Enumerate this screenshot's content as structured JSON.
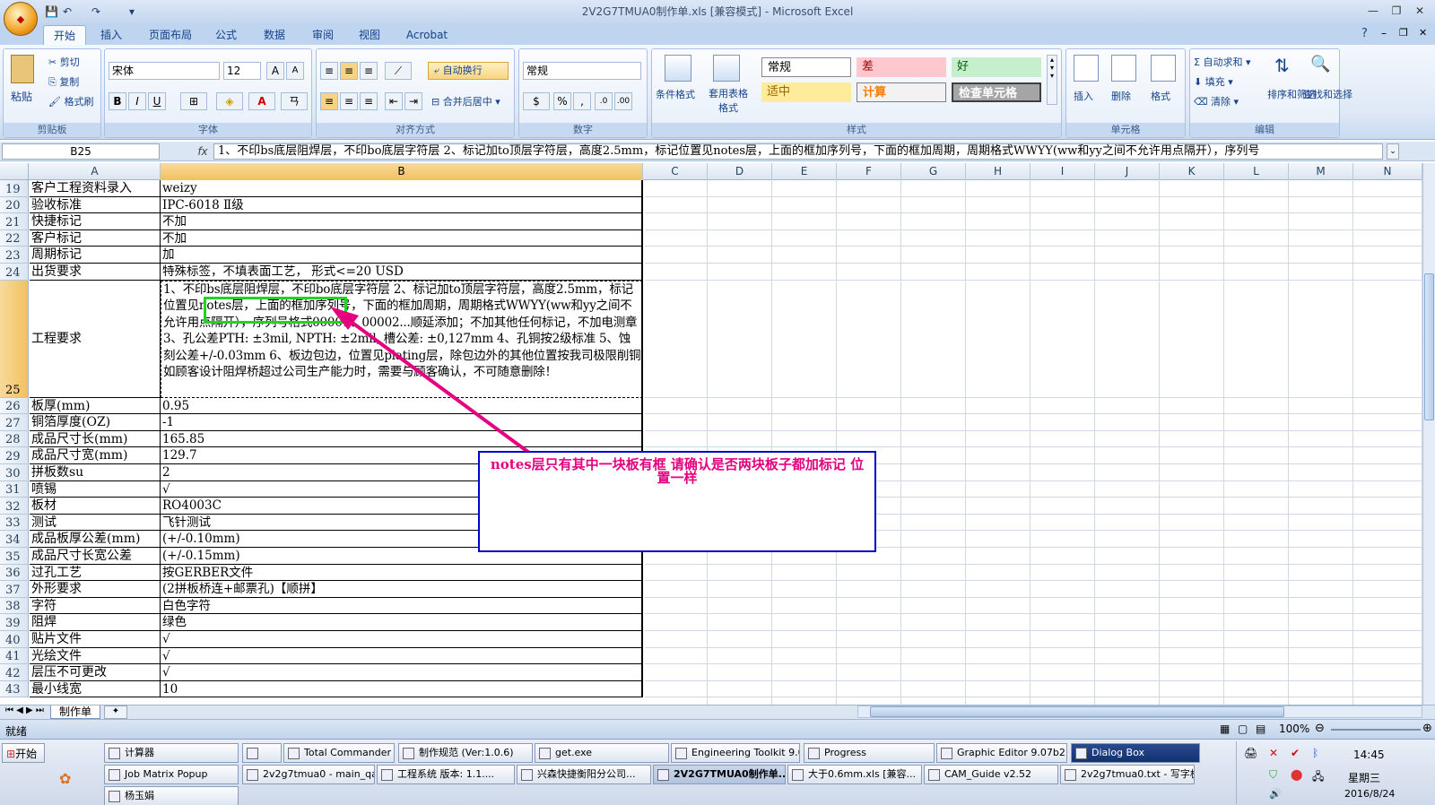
{
  "window": {
    "title": "2V2G7TMUA0制作单.xls  [兼容模式] - Microsoft Excel",
    "office_button": "Office"
  },
  "tabs": [
    "开始",
    "插入",
    "页面布局",
    "公式",
    "数据",
    "审阅",
    "视图",
    "Acrobat"
  ],
  "ribbon": {
    "clipboard": {
      "paste": "粘贴",
      "cut": "剪切",
      "copy": "复制",
      "format_painter": "格式刷",
      "label": "剪贴板"
    },
    "font": {
      "name": "宋体",
      "size": "12",
      "bold": "B",
      "italic": "I",
      "underline": "U",
      "label": "字体"
    },
    "align": {
      "wrap": "自动换行",
      "merge": "合并后居中",
      "label": "对齐方式"
    },
    "number": {
      "format": "常规",
      "label": "数字"
    },
    "styles": {
      "conditional": "条件格式",
      "table": "套用表格格式",
      "cells": [
        "常规",
        "差",
        "好",
        "适中",
        "计算",
        "检查单元格"
      ],
      "label": "样式"
    },
    "cells_group": {
      "insert": "插入",
      "delete": "删除",
      "format": "格式",
      "label": "单元格"
    },
    "editing": {
      "autosum": "自动求和",
      "fill": "填充",
      "clear": "清除",
      "sort": "排序和筛选",
      "find": "查找和选择",
      "label": "编辑"
    }
  },
  "formula_bar": {
    "name_box": "B25",
    "fx": "fx",
    "content": "1、不印bs底层阻焊层，不印bo底层字符层  2、标记加to顶层字符层，高度2.5mm，标记位置见notes层，上面的框加序列号，下面的框加周期，周期格式WWYY(ww和yy之间不允许用点隔开），序列号"
  },
  "columns": [
    "A",
    "B",
    "C",
    "D",
    "E",
    "F",
    "G",
    "H",
    "I",
    "J",
    "K",
    "L",
    "M",
    "N"
  ],
  "rows": [
    {
      "num": "19",
      "a": "客户工程资料录入",
      "b": "weizy"
    },
    {
      "num": "20",
      "a": "验收标准",
      "b": "IPC-6018 Ⅱ级"
    },
    {
      "num": "21",
      "a": "快捷标记",
      "b": "不加"
    },
    {
      "num": "22",
      "a": "客户标记",
      "b": "不加"
    },
    {
      "num": "23",
      "a": "周期标记",
      "b": "加"
    },
    {
      "num": "24",
      "a": "出货要求",
      "b": "特殊标签，不填表面工艺， 形式<=20 USD"
    },
    {
      "num": "25",
      "a": "工程要求",
      "b": "1、不印bs底层阻焊层，不印bo底层字符层  2、标记加to顶层字符层，高度2.5mm，标记位置见notes层，上面的框加序列号，下面的框加周期，周期格式WWYY(ww和yy之间不允许用点隔开），序列号格式00001、00002...顺延添加；不加其他任何标记，不加电测章   3、孔公差PTH: ±3mil,   NPTH: ±2mil,  槽公差: ±0,127mm   4、孔铜按2级标准  5、蚀刻公差+/-0.03mm  6、板边包边，位置见plating层，除包边外的其他位置按我司极限削铜如顾客设计阻焊桥超过公司生产能力时，需要与顾客确认，不可随意删除！"
    },
    {
      "num": "26",
      "a": "板厚(mm)",
      "b": "0.95"
    },
    {
      "num": "27",
      "a": "铜箔厚度(OZ)",
      "b": "-1"
    },
    {
      "num": "28",
      "a": "成品尺寸长(mm)",
      "b": "165.85"
    },
    {
      "num": "29",
      "a": "成品尺寸宽(mm)",
      "b": "129.7"
    },
    {
      "num": "30",
      "a": "拼板数su",
      "b": "2"
    },
    {
      "num": "31",
      "a": "喷锡",
      "b": "√"
    },
    {
      "num": "32",
      "a": "板材",
      "b": "RO4003C"
    },
    {
      "num": "33",
      "a": "测试",
      "b": "飞针测试"
    },
    {
      "num": "34",
      "a": "成品板厚公差(mm)",
      "b": "(+/-0.10mm)"
    },
    {
      "num": "35",
      "a": "成品尺寸长宽公差",
      "b": "(+/-0.15mm)"
    },
    {
      "num": "36",
      "a": "过孔工艺",
      "b": "按GERBER文件"
    },
    {
      "num": "37",
      "a": "外形要求",
      "b": "(2拼板桥连+邮票孔)【顺拼】"
    },
    {
      "num": "38",
      "a": "字符",
      "b": "白色字符"
    },
    {
      "num": "39",
      "a": "阻焊",
      "b": "绿色"
    },
    {
      "num": "40",
      "a": "贴片文件",
      "b": "√"
    },
    {
      "num": "41",
      "a": "光绘文件",
      "b": "√"
    },
    {
      "num": "42",
      "a": "层压不可更改",
      "b": "√"
    },
    {
      "num": "43",
      "a": "最小线宽",
      "b": "10"
    }
  ],
  "annotation": {
    "comment": "notes层只有其中一块板有框  请确认是否两块板子都加标记  位置一样",
    "arrow_color": "#e4007f",
    "box_color": "#22d422"
  },
  "sheet_tab": "制作单",
  "status": {
    "ready": "就绪",
    "zoom": "100%"
  },
  "taskbar": {
    "start": "开始",
    "tasks_row1": [
      "计算器",
      "",
      "Total Commander 7.0 ...",
      "制作规范 (Ver:1.0.6)",
      "get.exe",
      "Engineering Toolkit 9.0...",
      "Progress",
      "Graphic Editor 9.07b2 (...",
      "Dialog Box"
    ],
    "tasks_row2": [
      "Job Matrix Popup",
      "2v2g7tmua0 - main_qa",
      "工程系统  版本: 1.1....",
      "兴森快捷衡阳分公司...",
      "2V2G7TMUA0制作单...",
      "大于0.6mm.xls [兼容...",
      "CAM_Guide v2.52",
      "2v2g7tmua0.txt - 写字板"
    ],
    "tasks_row3": [
      "杨玉娟"
    ],
    "time": "14:45",
    "weekday": "星期三",
    "date": "2016/8/24"
  }
}
